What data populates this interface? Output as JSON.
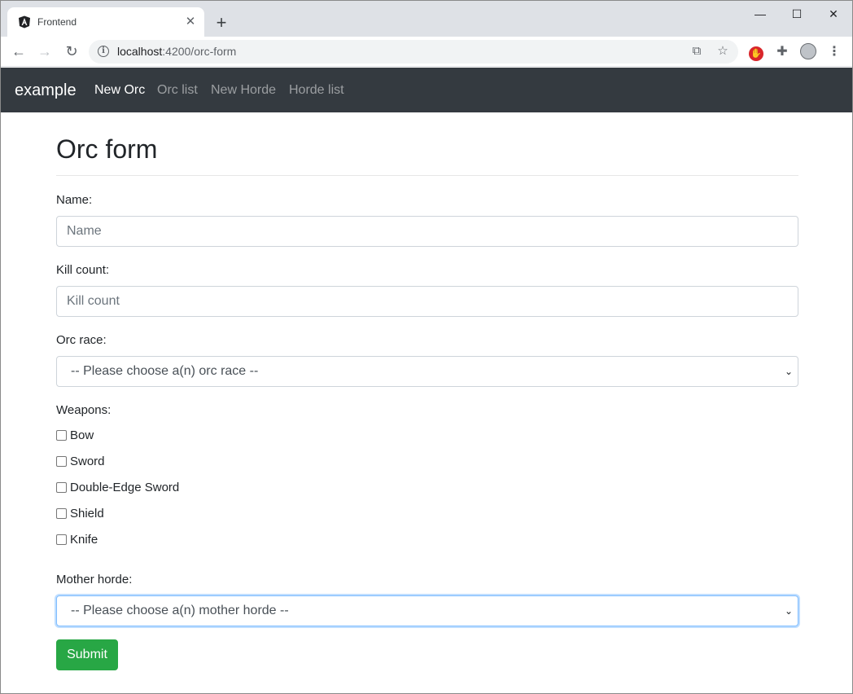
{
  "browser": {
    "tab_title": "Frontend",
    "tab_close": "✕",
    "new_tab": "+",
    "window_controls": {
      "minimize": "—",
      "maximize": "☐",
      "close": "✕"
    },
    "url_host": "localhost",
    "url_rest": ":4200/orc-form",
    "icons": {
      "back": "←",
      "forward": "→",
      "reload": "↻",
      "info": "i",
      "translate": "⧉",
      "star": "☆",
      "adblock": "✋",
      "extensions": "✚",
      "menu": "⋮"
    }
  },
  "navbar": {
    "brand": "example",
    "links": [
      "New Orc",
      "Orc list",
      "New Horde",
      "Horde list"
    ],
    "active_index": 0
  },
  "form": {
    "title": "Orc form",
    "name_label": "Name:",
    "name_placeholder": "Name",
    "kill_count_label": "Kill count:",
    "kill_count_placeholder": "Kill count",
    "orc_race_label": "Orc race:",
    "orc_race_selected": "-- Please choose a(n) orc race --",
    "weapons_label": "Weapons:",
    "weapons": [
      {
        "label": "Bow",
        "checked": false
      },
      {
        "label": "Sword",
        "checked": false
      },
      {
        "label": "Double-Edge Sword",
        "checked": false
      },
      {
        "label": "Shield",
        "checked": false
      },
      {
        "label": "Knife",
        "checked": false
      }
    ],
    "mother_horde_label": "Mother horde:",
    "mother_horde_selected": "-- Please choose a(n) mother horde --",
    "select_arrow": "⌄",
    "submit_label": "Submit"
  },
  "colors": {
    "navbar_bg": "#343a40",
    "submit_bg": "#28a745",
    "focus_border": "#80bdff"
  }
}
